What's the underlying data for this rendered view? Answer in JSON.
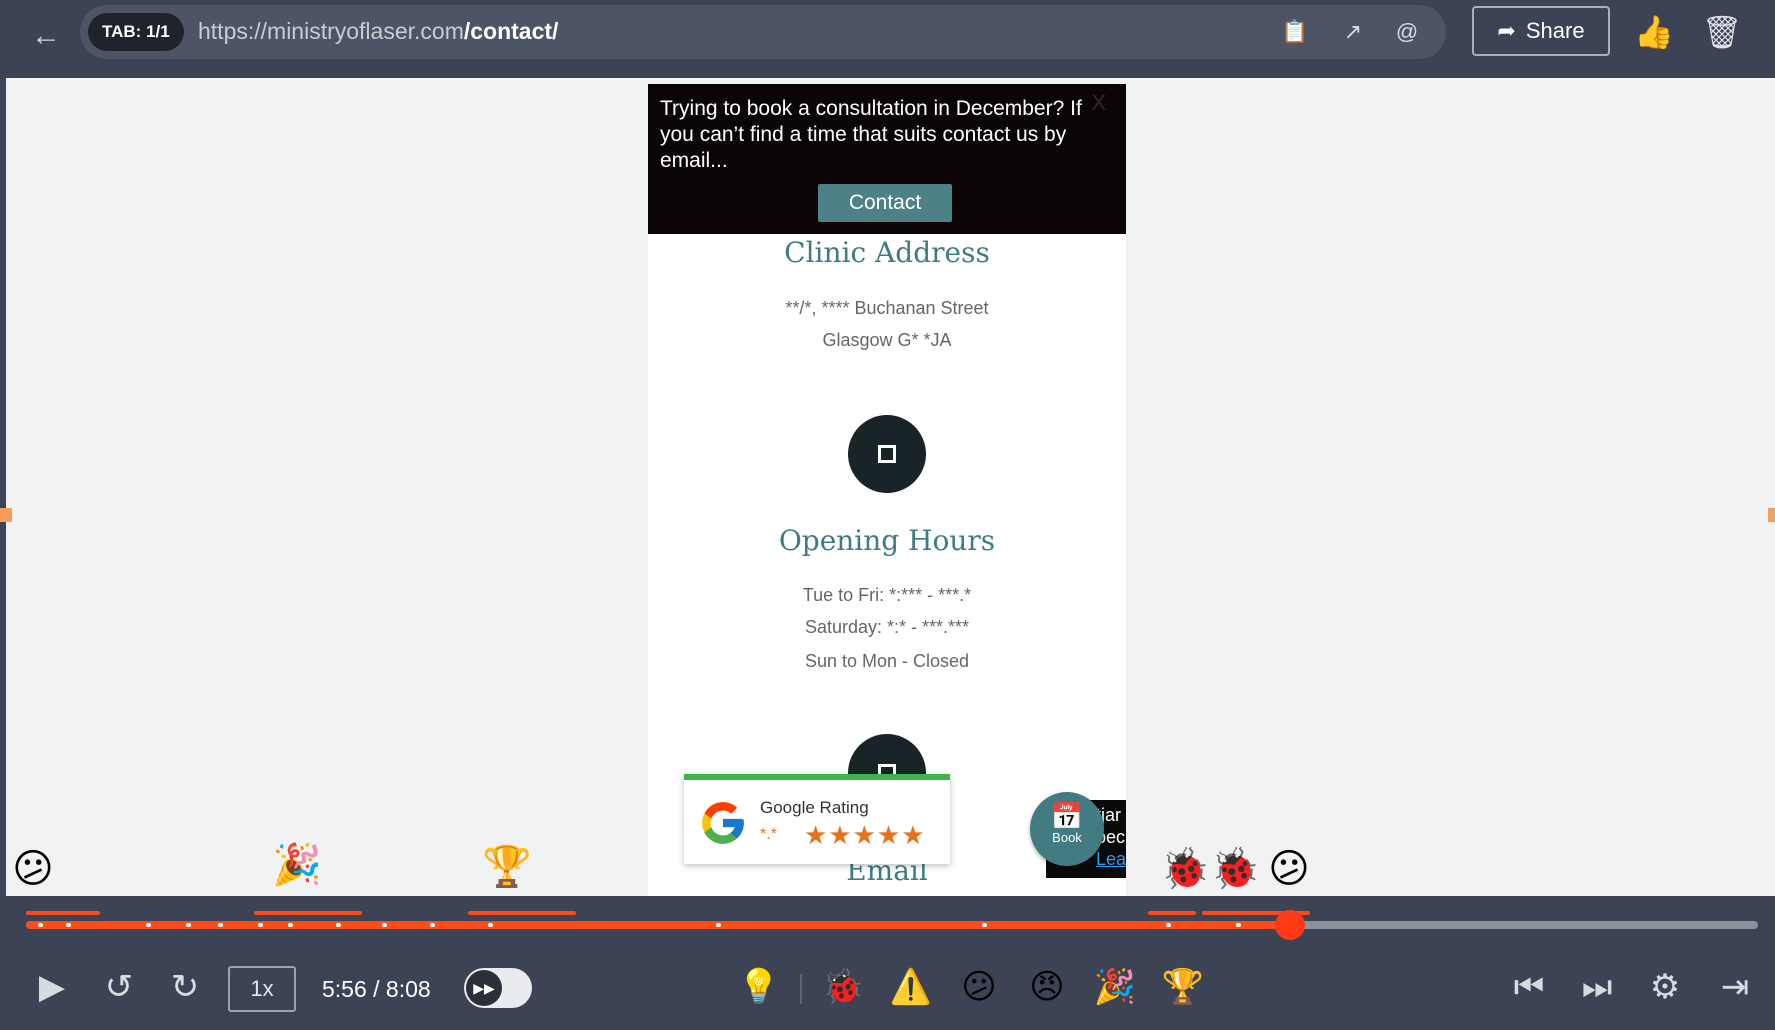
{
  "topbar": {
    "back_icon": "arrow-left-icon",
    "tab_label": "TAB: 1/1",
    "url_base": "https://ministryoflaser.com",
    "url_path": "/contact/",
    "share_label": "Share",
    "icons": [
      "clipboard-icon",
      "external-link-icon",
      "at-sign-icon",
      "thumbs-icon",
      "trash-icon"
    ]
  },
  "site": {
    "promo_text": "Trying to book a consultation in December? If you can’t find a time that suits contact us by email...",
    "promo_close": "X",
    "promo_button": "Contact",
    "address_title": "Clinic Address",
    "address_line1": "**/*, **** Buchanan Street",
    "address_line2": "Glasgow G* *JA",
    "hours_title": "Opening Hours",
    "hours_line1": "Tue to Fri: *:*** - ***.*",
    "hours_line2": "Saturday: *:* - ***.***",
    "hours_line3": "Sun to Mon - Closed",
    "email_title": "Email",
    "google_label": "Google Rating",
    "google_score": "*.*",
    "google_stars": "★★★★★",
    "book_label": "Book",
    "hotjar_text": "tjar bec",
    "hotjar_link": "Learn"
  },
  "markers": [
    "confused-face",
    "party-popper",
    "trophy",
    "ladybug",
    "ladybug",
    "confused-face"
  ],
  "player": {
    "speed": "1x",
    "time": "5:56 / 8:08",
    "progress": 0.73
  },
  "colors": {
    "accent": "#ff4a1c",
    "chrome": "#3c4354",
    "teal": "#3f7c82"
  }
}
